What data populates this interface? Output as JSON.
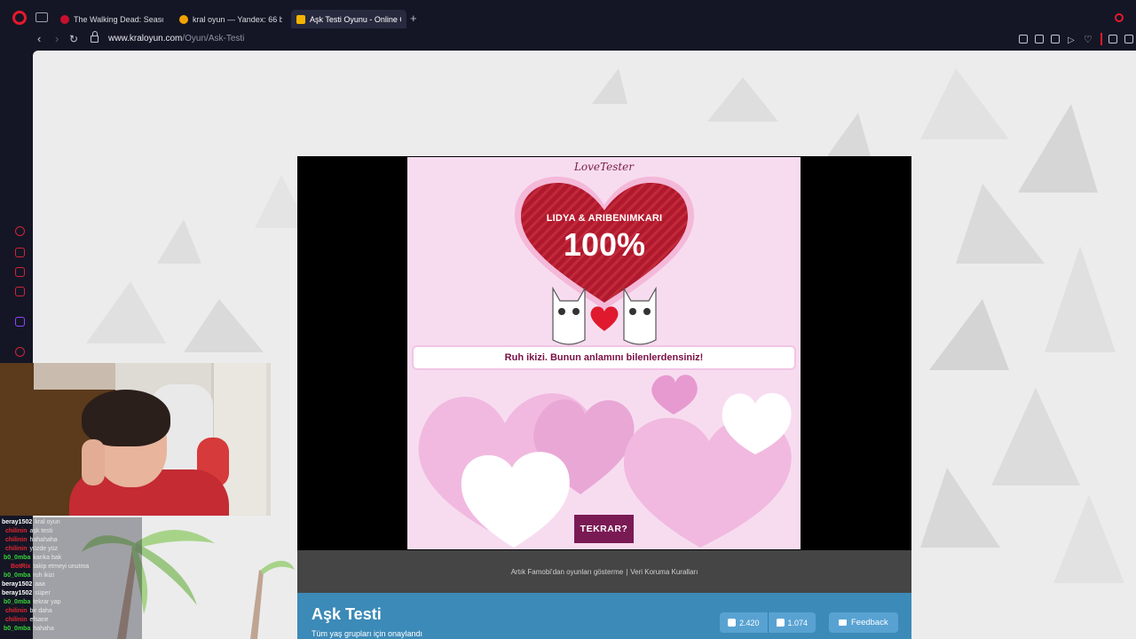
{
  "browser": {
    "tabs": [
      {
        "title": "The Walking Dead: Season",
        "favicon_color": "#c8102e",
        "active": false
      },
      {
        "title": "kral oyun — Yandex: 66 b",
        "favicon_color": "#f2a200",
        "active": false
      },
      {
        "title": "Aşk Testi Oyunu - Online O",
        "favicon_color": "#f5b301",
        "active": true
      }
    ],
    "new_tab_label": "+",
    "url_host": "www.kraloyun.com",
    "url_path": "/Oyun/Ask-Testi",
    "accent_color": "#e5192b",
    "sidebar_icons": [
      "history-icon",
      "speed-dial-icon",
      "pinboard-icon",
      "extensions-icon",
      "twitch-icon",
      "player-icon"
    ]
  },
  "game": {
    "logo": "LoveTester",
    "names": "LIDYA & ARIBENIMKARI",
    "percent": "100%",
    "result_message": "Ruh ikizi. Bunun anlamını bilenlerdensiniz!",
    "retry_label": "TEKRAR?",
    "heart_color": "#b0182c",
    "panel_color": "#f7dcf0"
  },
  "footer": {
    "text1": "Artık Famobi'dan oyunları gösterme",
    "separator": "|",
    "text2": "Veri Koruma Kuralları"
  },
  "info": {
    "title": "Aşk Testi",
    "subtitle": "Tüm yaş grupları için onaylandı",
    "likes": "2.420",
    "dislikes": "1.074",
    "feedback_label": "Feedback",
    "bar_color": "#3c8ab8"
  },
  "chat": [
    {
      "user": "beray1502",
      "color": "#ffffff",
      "msg": "kral oyun"
    },
    {
      "user": "chilinin",
      "color": "#e3262f",
      "msg": "aşk testi"
    },
    {
      "user": "chilinin",
      "color": "#e3262f",
      "msg": "hahahaha"
    },
    {
      "user": "chilinin",
      "color": "#e3262f",
      "msg": "yüzde yüz"
    },
    {
      "user": "b0_0mba",
      "color": "#39d339",
      "msg": "kanka bak"
    },
    {
      "user": "BotRix",
      "color": "#e3262f",
      "msg": "takip etmeyi unutma"
    },
    {
      "user": "b0_0mba",
      "color": "#39d339",
      "msg": "ruh ikizi"
    },
    {
      "user": "beray1502",
      "color": "#ffffff",
      "msg": "aaa"
    },
    {
      "user": "beray1502",
      "color": "#ffffff",
      "msg": "süper"
    },
    {
      "user": "b0_0mba",
      "color": "#39d339",
      "msg": "tekrar yap"
    },
    {
      "user": "chilinin",
      "color": "#e3262f",
      "msg": "bir daha"
    },
    {
      "user": "chilinin",
      "color": "#e3262f",
      "msg": "efsane"
    },
    {
      "user": "b0_0mba",
      "color": "#39d339",
      "msg": "hahaha"
    }
  ]
}
